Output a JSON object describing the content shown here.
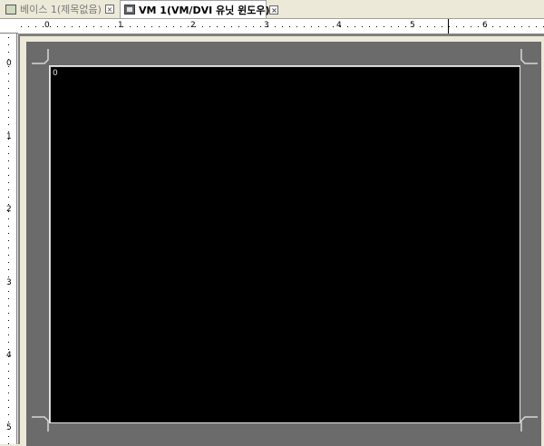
{
  "tabs": [
    {
      "label": "베이스 1(제목없음)",
      "icon": "screen-icon",
      "active": false
    },
    {
      "label": "VM 1(VM/DVI 유닛 윈도우)",
      "icon": "vm-window-icon",
      "active": true
    }
  ],
  "ruler": {
    "horizontal_labels": [
      "0",
      "1",
      "2",
      "3",
      "4",
      "5",
      "6"
    ],
    "vertical_labels": [
      "0",
      "1",
      "2",
      "3",
      "4",
      "5"
    ]
  },
  "screen": {
    "label": "0"
  },
  "colors": {
    "background": "#ece9d8",
    "frame": "#6b6b6b",
    "screen": "#000000",
    "ruler": "#ffffff"
  }
}
